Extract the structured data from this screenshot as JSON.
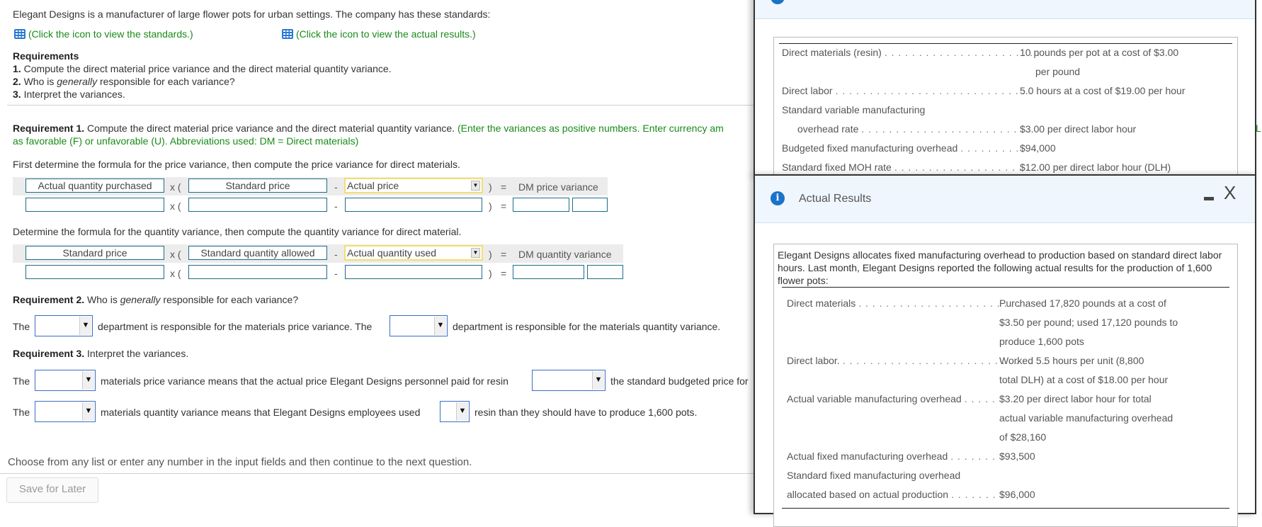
{
  "intro": "Elegant Designs is a manufacturer of large flower pots for urban settings. The company has these standards:",
  "links": {
    "standards": "(Click the icon to view the standards.)",
    "actual": "(Click the icon to view the actual results.)",
    "icon": "grid-icon"
  },
  "requirements": {
    "heading": "Requirements",
    "items": [
      {
        "num": "1.",
        "pre": "Compute the direct material price variance and the direct material quantity variance.",
        "em": "",
        "post": ""
      },
      {
        "num": "2.",
        "pre": "Who is ",
        "em": "generally",
        "post": " responsible for each variance?"
      },
      {
        "num": "3.",
        "pre": "Interpret the variances.",
        "em": "",
        "post": ""
      }
    ]
  },
  "req1": {
    "label": "Requirement 1.",
    "text": " Compute the direct material price variance and the direct material quantity variance.",
    "note_line1": " (Enter the variances as positive numbers. Enter currency am",
    "note_line2": "as favorable (F) or unfavorable (U). Abbreviations used: DM = Direct materials)",
    "price_intro": "First determine the formula for the price variance, then compute the price variance for direct materials.",
    "price_formula": {
      "box1": "Actual quantity purchased",
      "box2": "Standard price",
      "select": "Actual price",
      "result": "DM price variance"
    },
    "qty_intro": "Determine the formula for the quantity variance, then compute the quantity variance for direct material.",
    "qty_formula": {
      "box1": "Standard price",
      "box2": "Standard quantity allowed",
      "select": "Actual quantity used",
      "result": "DM quantity variance"
    },
    "ops": {
      "times": "x (",
      "minus": "-",
      "close": ")",
      "equals": "="
    }
  },
  "req2": {
    "label": "Requirement 2.",
    "pre": " Who is ",
    "em": "generally",
    "post": " responsible for each variance?",
    "sentence": {
      "the1": "The",
      "mid": "department is responsible for the materials price variance. The",
      "end": "department is responsible for the materials quantity variance."
    }
  },
  "req3": {
    "label": "Requirement 3.",
    "text": " Interpret the variances.",
    "line1": {
      "the": "The",
      "mid": "materials price variance means that the actual price Elegant Designs personnel paid for resin",
      "end": "the standard budgeted price for"
    },
    "line2": {
      "the": "The",
      "mid": "materials quantity variance means that Elegant Designs employees used",
      "end": "resin than they should have to produce 1,600 pots."
    }
  },
  "footer": {
    "hint": "Choose from any list or enter any number in the input fields and then continue to the next question.",
    "save": "Save for Later"
  },
  "standards_panel": {
    "rows": [
      {
        "label": "Direct materials (resin)",
        "dots": ". . . . . . . . . . . . . . . . . . . . . . .",
        "value": "10 pounds per pot at a cost of $3.00"
      },
      {
        "label": "",
        "dots": "",
        "value": "per pound"
      },
      {
        "label": "Direct labor",
        "dots": ". . . . . . . . . . . . . . . . . . . . . . . . . . . . . . .",
        "value": "5.0 hours at a cost of $19.00 per hour"
      },
      {
        "label": "Standard variable manufacturing",
        "dots": "",
        "value": ""
      },
      {
        "label": "overhead rate",
        "dots": ". . . . . . . . . . . . . . . . . . . . . . . . .",
        "value": "$3.00 per direct labor hour"
      },
      {
        "label": "Budgeted fixed manufacturing overhead",
        "dots": ". . . . . . . . .",
        "value": "$94,000"
      },
      {
        "label": "Standard fixed MOH rate",
        "dots": ". . . . . . . . . . . . . . . . . . . . . .",
        "value": "$12.00 per direct labor hour (DLH)"
      }
    ]
  },
  "actual_panel": {
    "title": "Actual Results",
    "intro": "Elegant Designs allocates fixed manufacturing overhead to production based on standard direct labor hours. Last month, Elegant Designs reported the following actual results for the production of 1,600 flower pots:",
    "rows": [
      {
        "label": "Direct materials",
        "dots": ". . . . . . . . . . . . . . . . . . . . . . . . .",
        "value": "Purchased 17,820 pounds at a cost of"
      },
      {
        "label": "",
        "dots": "",
        "value": "$3.50 per pound; used 17,120 pounds to"
      },
      {
        "label": "",
        "dots": "",
        "value": "produce 1,600 pots"
      },
      {
        "label": "Direct labor.",
        "dots": ". . . . . . . . . . . . . . . . . . . . . . . . . . . . . .",
        "value": "Worked 5.5 hours per unit (8,800"
      },
      {
        "label": "",
        "dots": "",
        "value": "total DLH) at a cost of $18.00 per hour"
      },
      {
        "label": "Actual variable manufacturing overhead",
        "dots": ". . . . .",
        "value": "$3.20 per direct labor hour for total"
      },
      {
        "label": "",
        "dots": "",
        "value": "actual variable manufacturing overhead"
      },
      {
        "label": "",
        "dots": "",
        "value": "of $28,160"
      },
      {
        "label": "Actual fixed manufacturing overhead",
        "dots": ". . . . . . .",
        "value": "$93,500"
      },
      {
        "label": "Standard fixed manufacturing overhead",
        "dots": "",
        "value": ""
      },
      {
        "label": "allocated based on actual production",
        "dots": ". . . . . . .",
        "value": "$96,000"
      }
    ],
    "minimize": "minimize",
    "close": "X"
  }
}
